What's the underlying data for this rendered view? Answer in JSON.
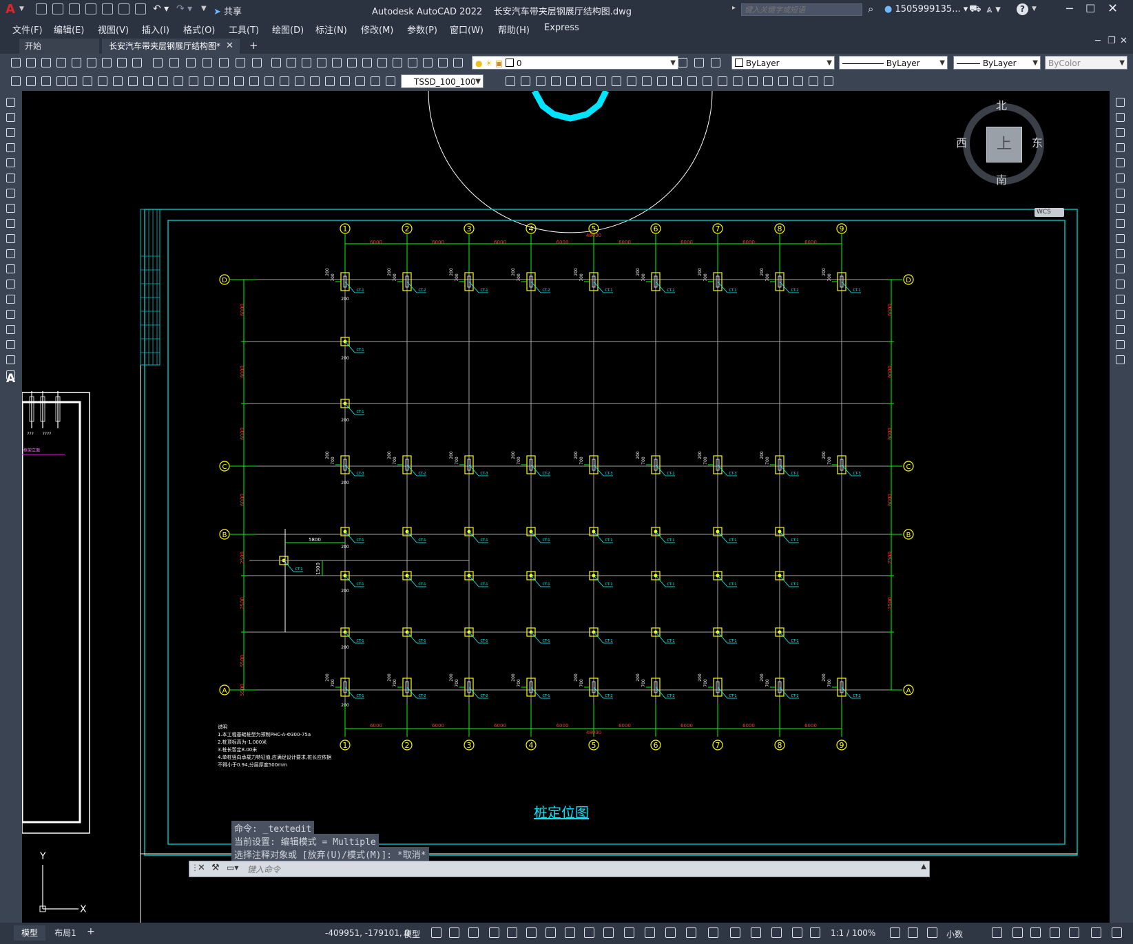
{
  "titlebar": {
    "logo": "A",
    "share": "共享",
    "title": "Autodesk AutoCAD 2022    长安汽车带夹层钢展厅结构图.dwg",
    "search_placeholder": "键入关键字或短语",
    "user": "1505999135...",
    "help": "?"
  },
  "menu": [
    "文件(F)",
    "编辑(E)",
    "视图(V)",
    "插入(I)",
    "格式(O)",
    "工具(T)",
    "绘图(D)",
    "标注(N)",
    "修改(M)",
    "参数(P)",
    "窗口(W)",
    "帮助(H)",
    "Express"
  ],
  "tabs": {
    "start": "开始",
    "active": "长安汽车带夹层钢展厅结构图*"
  },
  "toolbar1": {
    "layer": "0",
    "color": "ByLayer",
    "linetype": "ByLayer",
    "lineweight": "ByLayer",
    "plotstyle": "ByColor"
  },
  "toolbar2": {
    "dimstyle": "TSSD_100_100"
  },
  "viewcube": {
    "north": "北",
    "south": "南",
    "east": "东",
    "west": "西",
    "top": "上",
    "wcs": "WCS"
  },
  "drawing": {
    "title": "桩定位图",
    "columns": [
      "1",
      "2",
      "3",
      "4",
      "5",
      "6",
      "7",
      "8",
      "9"
    ],
    "rows": [
      "A",
      "B",
      "C",
      "D"
    ],
    "span_labels": [
      "6000",
      "6000",
      "6000",
      "6000",
      "6000",
      "6000",
      "6000",
      "6000"
    ],
    "total_length": "48000",
    "offset_labels": {
      "a": "200",
      "b": "700",
      "c": "250"
    },
    "dim_5800": "5800",
    "dim_1500": "1500",
    "pile_tags": {
      "cap1": "CT-1",
      "cap2": "CT-2",
      "cap3": "CT-3"
    },
    "notes": [
      "说明",
      "1.本工程基础桩型为预制PHC-A-Φ300-75a",
      "2.桩顶标高为-1.000米",
      "3.桩长暂定8.00米",
      "4.单桩竖向承载力特征值,应满足设计要求,桩长应依据",
      "  不得小于0.94,分层厚度500mm"
    ],
    "side_labels": [
      "框架立面",
      "???",
      "????"
    ],
    "left_dims": [
      "6000",
      "6000",
      "6000",
      "6000",
      "2500",
      "2500",
      "5500",
      "5500"
    ]
  },
  "command": {
    "history": [
      "命令: _textedit",
      "当前设置: 编辑模式 = Multiple",
      "选择注释对象或 [放弃(U)/模式(M)]: *取消*"
    ],
    "prompt": "键入命令"
  },
  "ucs": {
    "x": "X",
    "y": "Y"
  },
  "status": {
    "tab_model": "模型",
    "tab_layout": "布局1",
    "coords": "-409951, -179101, 0",
    "mode": "模型",
    "scale": "1:1 / 100%",
    "units": "小数"
  },
  "colors": {
    "bg": "#000000",
    "grid": "#a8a8a8",
    "dim": "#00ff00",
    "cap": "#ffff00",
    "tag": "#00ffff",
    "frame": "#00bcbc",
    "red_text": "#ff3030"
  }
}
